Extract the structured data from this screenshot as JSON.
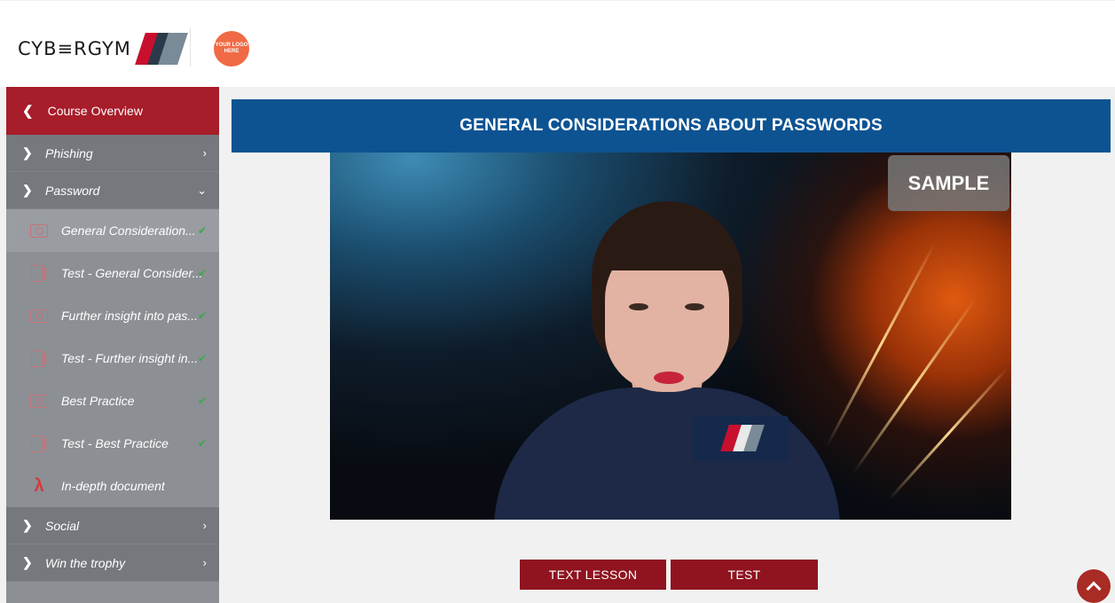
{
  "header": {
    "brand_text": "CYB≡RGYM",
    "client_logo_text": "YOUR LOGO HERE"
  },
  "sidebar": {
    "course_overview_label": "Course Overview",
    "sections": [
      {
        "label": "Phishing",
        "expanded": false
      },
      {
        "label": "Password",
        "expanded": true
      },
      {
        "label": "Social",
        "expanded": false
      },
      {
        "label": "Win the trophy",
        "expanded": false
      }
    ],
    "lessons": [
      {
        "label": "General Consideration...",
        "icon": "video-icon",
        "completed": true
      },
      {
        "label": "Test - General Consider...",
        "icon": "test-icon",
        "completed": true
      },
      {
        "label": "Further insight into pas...",
        "icon": "video-icon",
        "completed": true
      },
      {
        "label": "Test - Further insight in...",
        "icon": "test-icon",
        "completed": true
      },
      {
        "label": "Best Practice",
        "icon": "video-icon",
        "completed": true
      },
      {
        "label": "Test - Best Practice",
        "icon": "test-icon",
        "completed": true
      },
      {
        "label": "In-depth document",
        "icon": "pdf-icon",
        "completed": false
      }
    ]
  },
  "content": {
    "title": "GENERAL CONSIDERATIONS ABOUT PASSWORDS",
    "watermark": "SAMPLE",
    "buttons": {
      "text_lesson": "TEXT LESSON",
      "test": "TEST"
    }
  },
  "colors": {
    "brand_red": "#a71d2a",
    "title_blue": "#0d5392",
    "button_red": "#8f1420",
    "sidebar_gray": "#8c8f94"
  }
}
